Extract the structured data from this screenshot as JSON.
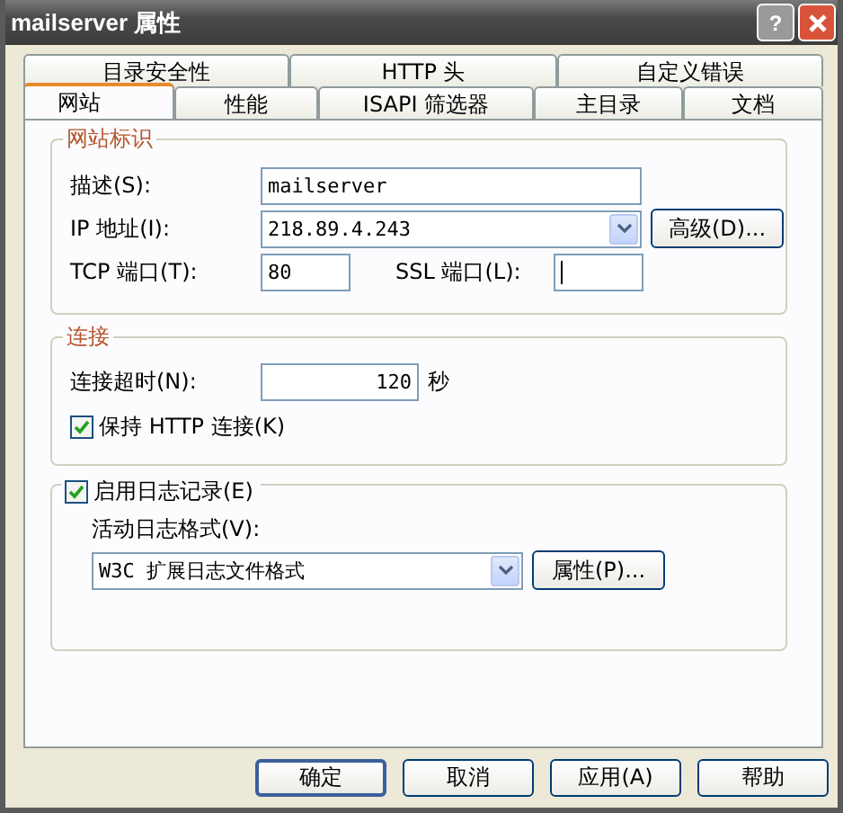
{
  "window": {
    "title": "mailserver 属性",
    "help_glyph": "?"
  },
  "tab_rows": [
    [
      {
        "label": "目录安全性",
        "selected": false
      },
      {
        "label": "HTTP 头",
        "selected": false
      },
      {
        "label": "自定义错误",
        "selected": false
      }
    ],
    [
      {
        "label": "网站",
        "selected": true
      },
      {
        "label": "性能",
        "selected": false
      },
      {
        "label": "ISAPI 筛选器",
        "selected": false
      },
      {
        "label": "主目录",
        "selected": false
      },
      {
        "label": "文档",
        "selected": false
      }
    ]
  ],
  "site_identity": {
    "title": "网站标识",
    "description_label": "描述(S):",
    "description_value": "mailserver",
    "ip_label": "IP 地址(I):",
    "ip_value": "218.89.4.243",
    "advanced_button": "高级(D)...",
    "tcp_label": "TCP 端口(T):",
    "tcp_value": "80",
    "ssl_label": "SSL 端口(L):"
  },
  "connection": {
    "title": "连接",
    "timeout_label": "连接超时(N):",
    "timeout_value": "120",
    "timeout_unit": "秒",
    "keepalive": {
      "label": "保持 HTTP 连接(K)",
      "checked": true
    }
  },
  "logging": {
    "enable": {
      "label": "启用日志记录(E)",
      "checked": true
    },
    "format_label": "活动日志格式(V):",
    "format_value": "W3C 扩展日志文件格式",
    "properties_button": "属性(P)..."
  },
  "buttons": [
    {
      "label": "确定",
      "kind": "default"
    },
    {
      "label": "取消",
      "kind": "normal"
    },
    {
      "label": "应用(A)",
      "kind": "normal"
    },
    {
      "label": "帮助",
      "kind": "normal"
    }
  ]
}
